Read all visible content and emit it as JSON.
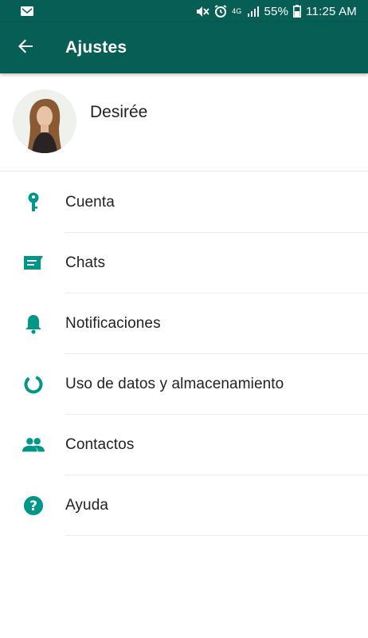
{
  "status_bar": {
    "battery": "55%",
    "time": "11:25 AM",
    "network": "4G",
    "icons": [
      "gmail-icon",
      "mute-icon",
      "alarm-icon",
      "signal-icon",
      "battery-icon"
    ]
  },
  "app_bar": {
    "title": "Ajustes",
    "back_icon": "arrow-back-icon"
  },
  "profile": {
    "name": "Desirée"
  },
  "settings": {
    "items": [
      {
        "label": "Cuenta",
        "icon": "key-icon"
      },
      {
        "label": "Chats",
        "icon": "chat-icon"
      },
      {
        "label": "Notificaciones",
        "icon": "bell-icon"
      },
      {
        "label": "Uso de datos y almacenamiento",
        "icon": "data-usage-icon"
      },
      {
        "label": "Contactos",
        "icon": "contacts-icon"
      },
      {
        "label": "Ayuda",
        "icon": "help-icon"
      }
    ]
  },
  "colors": {
    "primary": "#075e54",
    "accent": "#009688",
    "text": "#222222"
  }
}
